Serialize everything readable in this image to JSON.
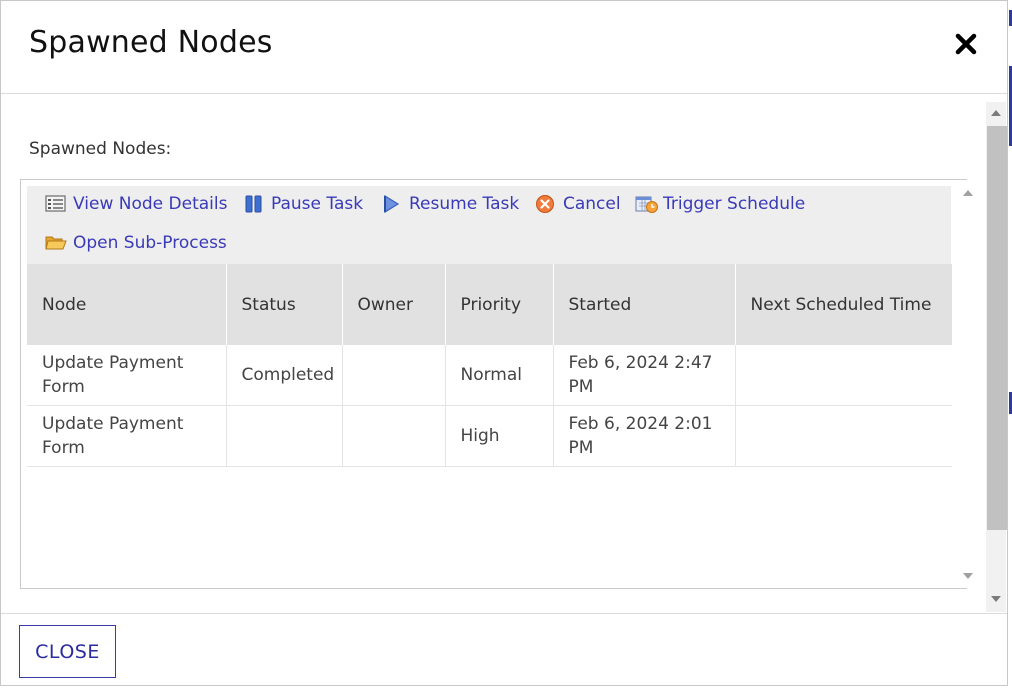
{
  "dialog": {
    "title": "Spawned Nodes",
    "close_icon": "close-x-icon"
  },
  "body": {
    "label": "Spawned Nodes:"
  },
  "toolbar": {
    "items": [
      {
        "label": "View Node Details",
        "icon": "list-icon"
      },
      {
        "label": "Pause Task",
        "icon": "pause-icon"
      },
      {
        "label": "Resume Task",
        "icon": "resume-icon"
      },
      {
        "label": "Cancel",
        "icon": "cancel-icon"
      },
      {
        "label": "Trigger Schedule",
        "icon": "schedule-icon"
      },
      {
        "label": "Open Sub-Process",
        "icon": "folder-open-icon"
      }
    ]
  },
  "table": {
    "columns": [
      "Node",
      "Status",
      "Owner",
      "Priority",
      "Started",
      "Next Scheduled Time"
    ],
    "rows": [
      {
        "node": "Update Payment Form",
        "status": "Completed",
        "owner": "",
        "priority": "Normal",
        "started": "Feb 6, 2024 2:47 PM",
        "next": ""
      },
      {
        "node": "Update Payment Form",
        "status": "",
        "owner": "",
        "priority": "High",
        "started": "Feb 6, 2024 2:01 PM",
        "next": ""
      }
    ]
  },
  "footer": {
    "close_label": "CLOSE"
  },
  "colors": {
    "link": "#3a3ab8",
    "header_bg": "#e1e1e1",
    "toolbar_bg": "#eeeeee",
    "button_border": "#3a3aa8"
  }
}
